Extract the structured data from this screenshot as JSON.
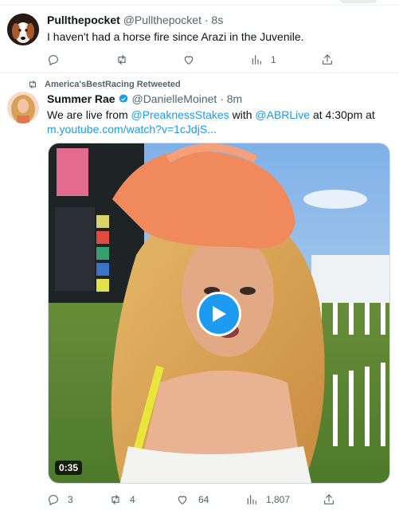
{
  "tweets": [
    {
      "name": "Pullthepocket",
      "handle": "@Pullthepocket",
      "separator": "·",
      "time": "8s",
      "text": "I haven't had a horse fire since Arazi in the Juvenile.",
      "views": "1",
      "avatar_icon": "dog-avatar"
    },
    {
      "retweet_label": "America'sBestRacing Retweeted",
      "name": "Summer Rae",
      "handle": "@DanielleMoinet",
      "separator": "·",
      "time": "8m",
      "text_parts": {
        "t1": "We are live from ",
        "m1": "@PreaknessStakes",
        "t2": " with ",
        "m2": "@ABRLive",
        "t3": " at 4:30pm at",
        "url": "m.youtube.com/watch?v=1cJdjS..."
      },
      "video": {
        "duration": "0:35",
        "play_icon": "play-icon"
      },
      "counts": {
        "replies": "3",
        "retweets": "4",
        "likes": "64",
        "views": "1,807"
      }
    }
  ],
  "colors": {
    "accent": "#1d9bf0",
    "muted": "#536471",
    "text": "#0f1419"
  }
}
